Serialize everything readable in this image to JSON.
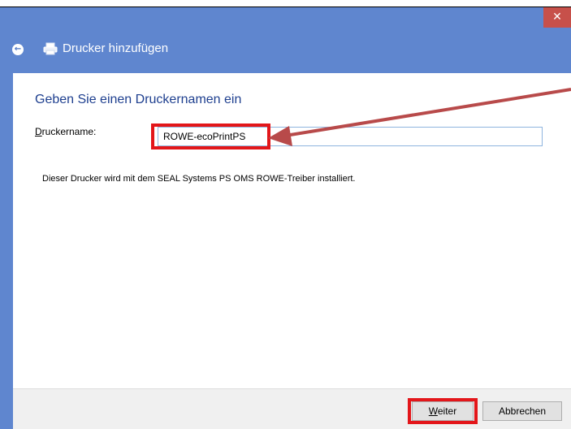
{
  "window": {
    "title": "Drucker hinzufügen",
    "close_glyph": "✕",
    "back_glyph": "←"
  },
  "content": {
    "heading": "Geben Sie einen Druckernamen ein",
    "name_label_first": "D",
    "name_label_rest": "ruckername:",
    "name_value": "ROWE-ecoPrintPS",
    "info": "Dieser Drucker wird mit dem SEAL Systems PS OMS ROWE-Treiber installiert."
  },
  "footer": {
    "next_first": "W",
    "next_rest": "eiter",
    "cancel": "Abbrechen"
  },
  "colors": {
    "titlebar": "#5f86cf",
    "close": "#c7504a",
    "heading": "#1e3f8f",
    "highlight": "#e3161a",
    "arrow": "#b84a4a"
  },
  "icons": [
    "back-icon",
    "printer-icon",
    "close-icon",
    "annotation-arrow"
  ]
}
